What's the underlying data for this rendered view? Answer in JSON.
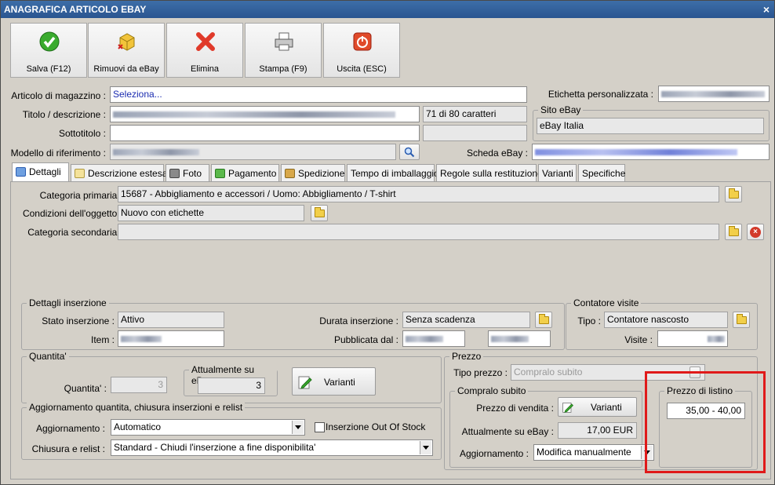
{
  "window": {
    "title": "ANAGRAFICA ARTICOLO EBAY",
    "close": "×"
  },
  "toolbar": {
    "save": "Salva (F12)",
    "remove": "Rimuovi da eBay",
    "delete": "Elimina",
    "print": "Stampa (F9)",
    "exit": "Uscita (ESC)"
  },
  "header": {
    "article_label": "Articolo di magazzino :",
    "article_value": "Seleziona...",
    "title_label": "Titolo / descrizione :",
    "title_counter": "71 di 80 caratteri",
    "subtitle_label": "Sottotitolo :",
    "model_label": "Modello di riferimento :",
    "custom_label_label": "Etichetta personalizzata :",
    "site_group": "Sito eBay",
    "site_value": "eBay Italia",
    "scheda_label": "Scheda eBay :"
  },
  "tabs": [
    {
      "label": "Dettagli"
    },
    {
      "label": "Descrizione estesa"
    },
    {
      "label": "Foto"
    },
    {
      "label": "Pagamento"
    },
    {
      "label": "Spedizione"
    },
    {
      "label": "Tempo di imballaggio"
    },
    {
      "label": "Regole sulla restituzione"
    },
    {
      "label": "Varianti"
    },
    {
      "label": "Specifiche"
    }
  ],
  "details": {
    "primary_cat_label": "Categoria primaria :",
    "primary_cat_value": "15687 - Abbigliamento e accessori / Uomo: Abbigliamento / T-shirt",
    "condition_label": "Condizioni dell'oggetto :",
    "condition_value": "Nuovo con etichette",
    "secondary_cat_label": "Categoria secondaria :"
  },
  "listing": {
    "group": "Dettagli inserzione",
    "status_label": "Stato inserzione :",
    "status_value": "Attivo",
    "item_label": "Item :",
    "duration_label": "Durata inserzione :",
    "duration_value": "Senza scadenza",
    "published_label": "Pubblicata dal :"
  },
  "counter": {
    "group": "Contatore visite",
    "type_label": "Tipo :",
    "type_value": "Contatore nascosto",
    "visits_label": "Visite :"
  },
  "quantity": {
    "group": "Quantita'",
    "qty_label": "Quantita' :",
    "qty_value": "3",
    "current_group": "Attualmente su eBay",
    "current_value": "3",
    "variants_button": "Varianti"
  },
  "update": {
    "group": "Aggiornamento quantita, chiusura inserzioni e relist",
    "update_label": "Aggiornamento :",
    "update_value": "Automatico",
    "oos_label": "Inserzione Out Of Stock",
    "close_label": "Chiusura e relist :",
    "close_value": "Standard - Chiudi l'inserzione a fine disponibilita'"
  },
  "price": {
    "group": "Prezzo",
    "type_label": "Tipo prezzo :",
    "type_value": "Compralo subito",
    "buy_group": "Compralo subito",
    "sale_label": "Prezzo di vendita :",
    "variants_button": "Varianti",
    "current_label": "Attualmente su eBay :",
    "current_value": "17,00 EUR",
    "update_label": "Aggiornamento :",
    "update_value": "Modifica manualmente",
    "list_group": "Prezzo di listino",
    "list_value": "35,00 - 40,00"
  },
  "colors": {
    "title_bar": "#2f5f9c",
    "highlight": "#e01a1a",
    "window_bg": "#d4d0c8"
  }
}
